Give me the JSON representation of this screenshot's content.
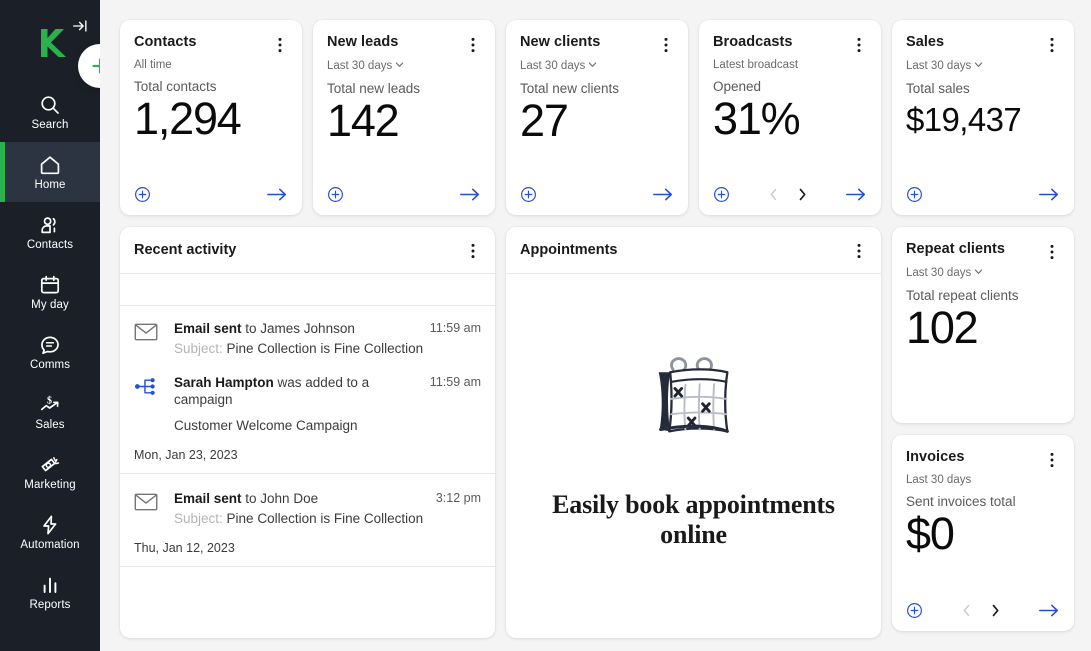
{
  "theme": {
    "sidebar_bg": "#1b2028",
    "sidebar_active_bg": "#2b3440",
    "accent_green": "#2bb24c",
    "accent_blue": "#2250d9",
    "page_bg": "#f4f4f4",
    "card_bg": "#ffffff"
  },
  "sidebar": {
    "logo_name": "keap-logo",
    "expand_label": "Expand navigation",
    "add_label": "Add new",
    "items": [
      {
        "label": "Search",
        "icon": "search-icon",
        "active": false
      },
      {
        "label": "Home",
        "icon": "home-icon",
        "active": true
      },
      {
        "label": "Contacts",
        "icon": "contacts-icon",
        "active": false
      },
      {
        "label": "My day",
        "icon": "calendar-icon",
        "active": false
      },
      {
        "label": "Comms",
        "icon": "chat-icon",
        "active": false
      },
      {
        "label": "Sales",
        "icon": "sales-icon",
        "active": false
      },
      {
        "label": "Marketing",
        "icon": "megaphone-icon",
        "active": false
      },
      {
        "label": "Automation",
        "icon": "lightning-icon",
        "active": false
      },
      {
        "label": "Reports",
        "icon": "bar-chart-icon",
        "active": false
      }
    ]
  },
  "kpi_cards": [
    {
      "title": "Contacts",
      "range": "All time",
      "range_has_chevron": false,
      "metric_label": "Total contacts",
      "value": "1,294",
      "has_add": true,
      "has_pager": false,
      "has_arrow": true
    },
    {
      "title": "New leads",
      "range": "Last 30 days",
      "range_has_chevron": true,
      "metric_label": "Total new leads",
      "value": "142",
      "has_add": true,
      "has_pager": false,
      "has_arrow": true
    },
    {
      "title": "New clients",
      "range": "Last 30 days",
      "range_has_chevron": true,
      "metric_label": "Total new clients",
      "value": "27",
      "has_add": true,
      "has_pager": false,
      "has_arrow": true
    },
    {
      "title": "Broadcasts",
      "range": "Latest broadcast",
      "range_has_chevron": false,
      "metric_label": "Opened",
      "value": "31%",
      "has_add": true,
      "has_pager": true,
      "has_arrow": true
    },
    {
      "title": "Sales",
      "range": "Last 30 days",
      "range_has_chevron": true,
      "metric_label": "Total sales",
      "value": "$19,437",
      "has_add": true,
      "has_pager": false,
      "has_arrow": true
    }
  ],
  "recent_activity": {
    "title": "Recent activity",
    "items": [
      {
        "icon": "envelope-icon",
        "actor": "Email sent",
        "rest": " to James Johnson",
        "time": "11:59 am",
        "time_wraps": false,
        "subject_label": "Subject:",
        "subject_text": "Pine Collection is Fine Collection",
        "extra": "",
        "date": ""
      },
      {
        "icon": "campaign-icon",
        "actor": "Sarah Hampton",
        "rest": " was added to a campaign",
        "time": "11:59 am",
        "time_wraps": true,
        "subject_label": "",
        "subject_text": "",
        "extra": "Customer Welcome Campaign",
        "date": "Mon, Jan 23, 2023"
      },
      {
        "icon": "envelope-icon",
        "actor": "Email sent",
        "rest": " to John Doe",
        "time": "3:12 pm",
        "time_wraps": false,
        "subject_label": "Subject:",
        "subject_text": "Pine Collection is Fine Collection",
        "extra": "",
        "date": "Thu, Jan 12, 2023"
      }
    ]
  },
  "appointments": {
    "title": "Appointments",
    "illustration": "calendar-illustration",
    "empty_heading": "Easily book appointments online"
  },
  "repeat_clients": {
    "title": "Repeat clients",
    "range": "Last 30 days",
    "range_has_chevron": true,
    "metric_label": "Total repeat clients",
    "value": "102"
  },
  "invoices": {
    "title": "Invoices",
    "range": "Last 30 days",
    "range_has_chevron": false,
    "metric_label": "Sent invoices total",
    "value": "$0"
  }
}
